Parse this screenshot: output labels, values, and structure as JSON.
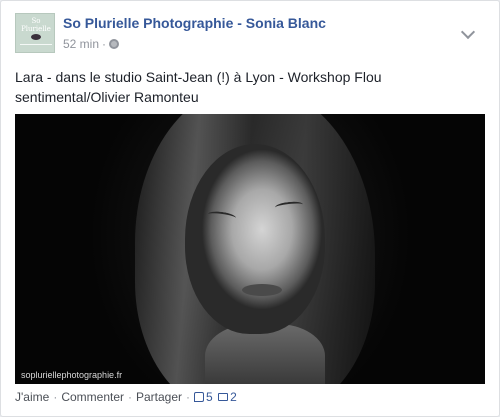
{
  "post": {
    "page_name": "So Plurielle Photographie - Sonia Blanc",
    "time": "52 min",
    "visibility_icon": "globe-icon",
    "menu_icon": "chevron-down-icon",
    "avatar_text": "So Plurielle",
    "caption": "Lara - dans le studio Saint-Jean (!) à Lyon - Workshop Flou sentimental/Olivier Ramonteu",
    "photo_watermark": "sopluriellephotographie.fr"
  },
  "actions": {
    "like_label": "J'aime",
    "comment_label": "Commenter",
    "share_label": "Partager",
    "separator": "·",
    "like_count": "5",
    "comment_count": "2"
  },
  "colors": {
    "link_blue": "#365899",
    "meta_gray": "#90949c",
    "text": "#1d2129"
  }
}
